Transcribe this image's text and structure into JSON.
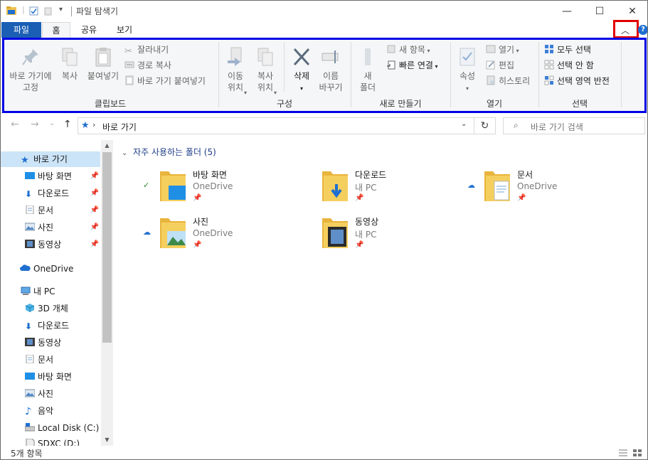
{
  "window": {
    "title": "파일 탐색기",
    "minimize": "—",
    "maximize": "☐",
    "close": "✕"
  },
  "tabs": [
    {
      "label": "파일"
    },
    {
      "label": "홈"
    },
    {
      "label": "공유"
    },
    {
      "label": "보기"
    }
  ],
  "ribbon": {
    "clipboard": {
      "label": "클립보드",
      "pin": "바로 가기에\n고정",
      "copy": "복사",
      "paste": "붙여넣기",
      "cut": "잘라내기",
      "copy_path": "경로 복사",
      "paste_shortcut": "바로 가기 붙여넣기"
    },
    "organize": {
      "label": "구성",
      "move_to": "이동\n위치",
      "copy_to": "복사\n위치",
      "delete": "삭제",
      "rename": "이름\n바꾸기"
    },
    "new": {
      "label": "새로 만들기",
      "new_folder": "새\n폴더",
      "new_item": "새 항목",
      "easy_access": "빠른 연결"
    },
    "open": {
      "label": "열기",
      "properties": "속성",
      "open": "열기",
      "edit": "편집",
      "history": "히스토리"
    },
    "select": {
      "label": "선택",
      "select_all": "모두 선택",
      "select_none": "선택 안 함",
      "invert": "선택 영역 반전"
    }
  },
  "nav": {
    "back": "←",
    "forward": "→",
    "recent": "⌄",
    "up": "↑",
    "address": "바로 가기",
    "refresh": "↻",
    "search_placeholder": "바로 가기 검색"
  },
  "sidebar": {
    "quick_access": "바로 가기",
    "quick_items": [
      "바탕 화면",
      "다운로드",
      "문서",
      "사진",
      "동영상"
    ],
    "onedrive": "OneDrive",
    "this_pc": "내 PC",
    "pc_items": [
      "3D 개체",
      "다운로드",
      "동영상",
      "문서",
      "바탕 화면",
      "사진",
      "음악",
      "Local Disk (C:)",
      "SDXC (D:)"
    ]
  },
  "content": {
    "section_title": "자주 사용하는 폴더 (5)",
    "folders": [
      {
        "name": "바탕 화면",
        "sub": "OneDrive",
        "status": "synced"
      },
      {
        "name": "다운로드",
        "sub": "내 PC",
        "status": "none"
      },
      {
        "name": "문서",
        "sub": "OneDrive",
        "status": "cloud"
      },
      {
        "name": "사진",
        "sub": "OneDrive",
        "status": "cloud"
      },
      {
        "name": "동영상",
        "sub": "내 PC",
        "status": "none"
      }
    ]
  },
  "status": {
    "item_count": "5개 항목"
  },
  "colors": {
    "accent": "#1a5fb4",
    "highlight_red": "#e00000",
    "highlight_blue": "#0000e6",
    "folder": "#f0c24f"
  }
}
